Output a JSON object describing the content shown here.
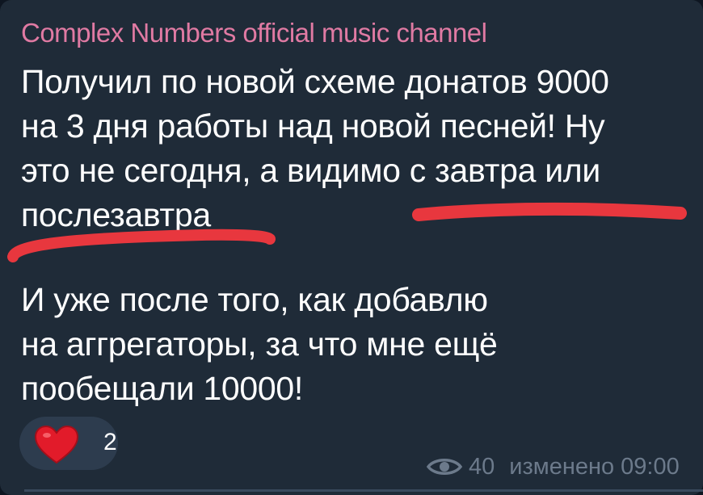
{
  "message": {
    "channel_name": "Complex Numbers official music channel",
    "paragraph1_lines": [
      "Получил по новой схеме донатов 9000",
      "на 3 дня работы над новой песней! Ну",
      "это не сегодня, а видимо с завтра или",
      "послезавтра"
    ],
    "paragraph2_lines": [
      "И уже после того, как добавлю",
      "на аггрегаторы, за что мне ещё",
      "пообещали 10000!"
    ]
  },
  "reaction": {
    "emoji": "heart-icon",
    "count": "2"
  },
  "meta": {
    "views": "40",
    "edited_label": "изменено",
    "time": "09:00"
  },
  "colors": {
    "bubble": "#1f2b38",
    "channel_name": "#e07aa3",
    "annotation_red": "#e8373e",
    "meta_gray": "#6c7a8b"
  }
}
